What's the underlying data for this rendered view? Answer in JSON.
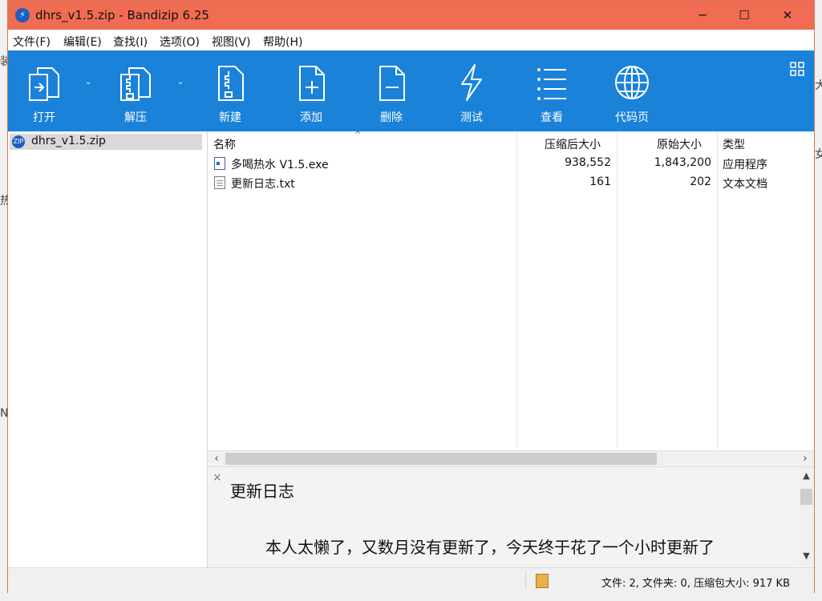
{
  "window": {
    "title": "dhrs_v1.5.zip - Bandizip 6.25",
    "minimize_glyph": "─",
    "maximize_glyph": "☐",
    "close_glyph": "✕",
    "titlebar_color": "#f06c52"
  },
  "menu": {
    "items": [
      "文件(F)",
      "编辑(E)",
      "查找(I)",
      "选项(O)",
      "视图(V)",
      "帮助(H)"
    ]
  },
  "toolbar": {
    "color": "#1a82d9",
    "buttons": [
      {
        "label": "打开",
        "icon": "open-icon",
        "has_dropdown": true
      },
      {
        "label": "解压",
        "icon": "extract-icon",
        "has_dropdown": true
      },
      {
        "label": "新建",
        "icon": "new-archive-icon",
        "has_dropdown": false
      },
      {
        "label": "添加",
        "icon": "add-file-icon",
        "has_dropdown": false
      },
      {
        "label": "删除",
        "icon": "delete-file-icon",
        "has_dropdown": false
      },
      {
        "label": "测试",
        "icon": "test-bolt-icon",
        "has_dropdown": false
      },
      {
        "label": "查看",
        "icon": "view-list-icon",
        "has_dropdown": false
      },
      {
        "label": "代码页",
        "icon": "codepage-globe-icon",
        "has_dropdown": false
      }
    ]
  },
  "sidebar": {
    "items": [
      {
        "label": "dhrs_v1.5.zip",
        "icon": "zip-archive-icon"
      }
    ]
  },
  "filelist": {
    "columns": [
      "名称",
      "压缩后大小",
      "原始大小",
      "类型"
    ],
    "rows": [
      {
        "name": "多喝热水 V1.5.exe",
        "compressed": "938,552",
        "original": "1,843,200",
        "type": "应用程序",
        "icon": "exe-file-icon"
      },
      {
        "name": "更新日志.txt",
        "compressed": "161",
        "original": "202",
        "type": "文本文档",
        "icon": "text-file-icon"
      }
    ]
  },
  "preview": {
    "close_glyph": "×",
    "title": "更新日志",
    "body": "本人太懒了，又数月没有更新了，今天终于花了一个小时更新了"
  },
  "statusbar": {
    "text": "文件: 2, 文件夹: 0, 压缩包大小: 917 KB"
  },
  "background": {
    "edge_fragments": [
      "装",
      "热",
      "N",
      "大",
      "女"
    ]
  }
}
